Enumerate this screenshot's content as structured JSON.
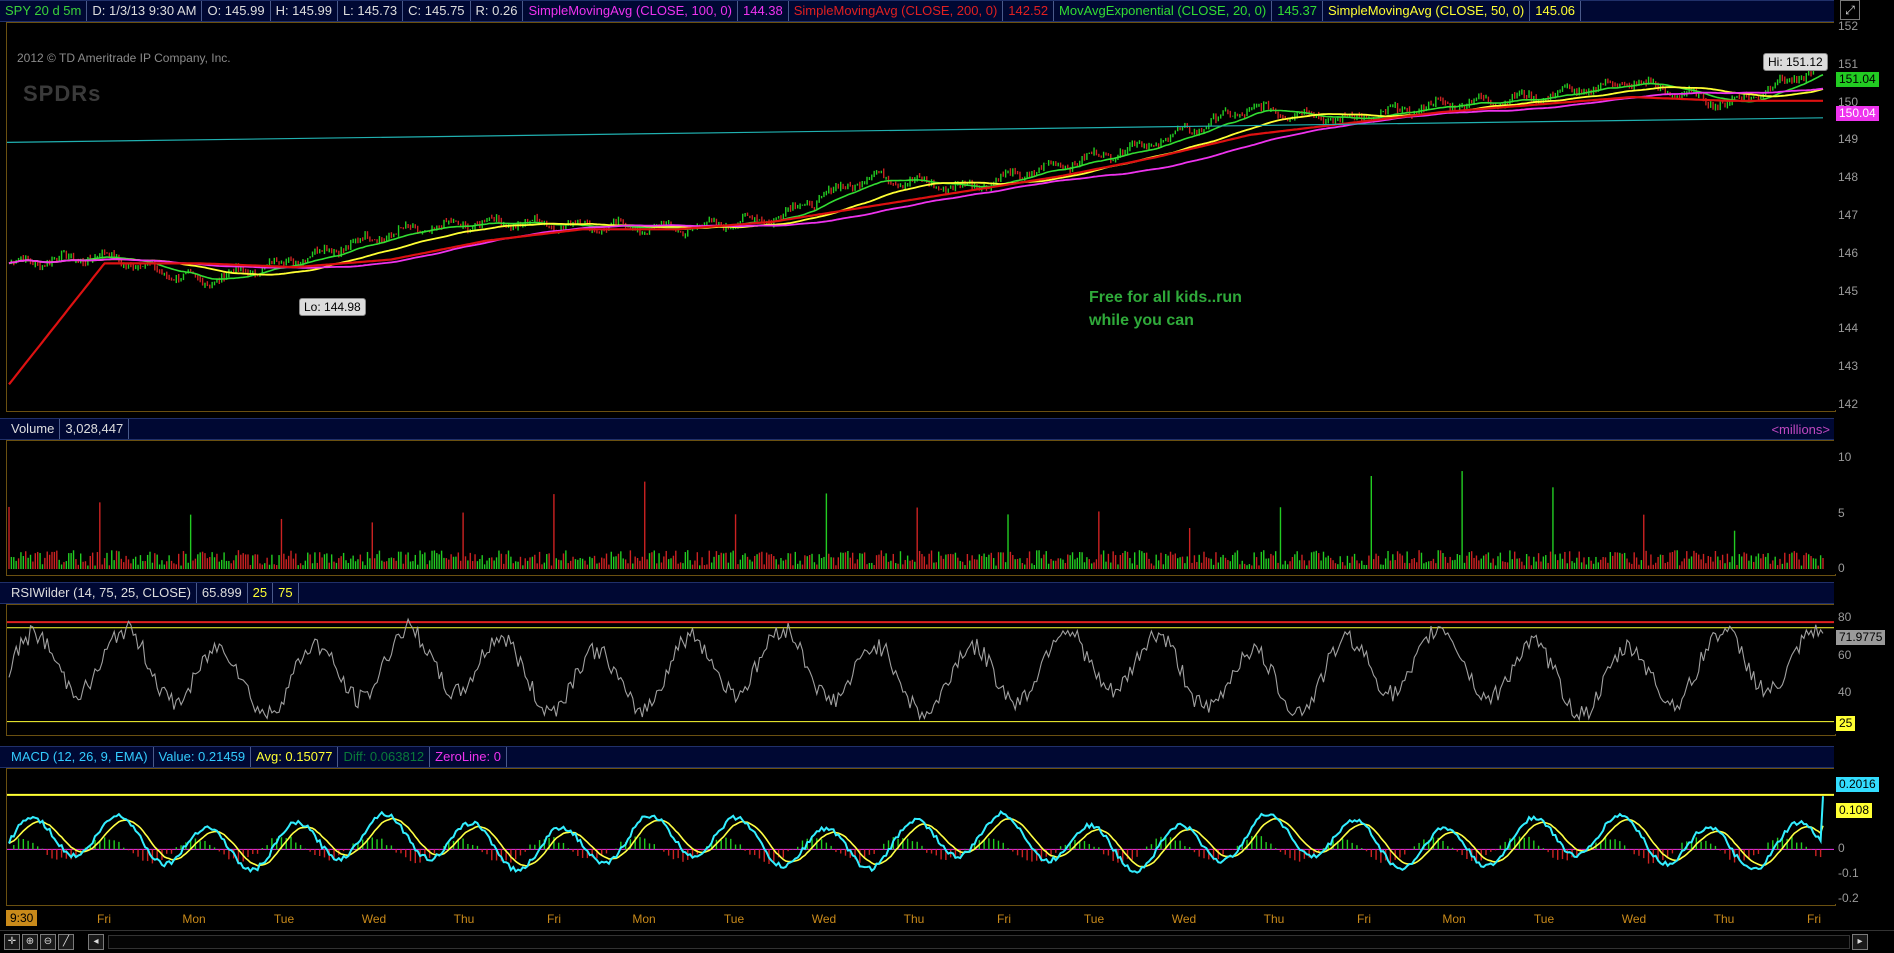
{
  "top_bar": {
    "symbol": "SPY 20 d 5m",
    "datetime": "D: 1/3/13 9:30 AM",
    "open": "O: 145.99",
    "high": "H: 145.99",
    "low": "L: 145.73",
    "close": "C: 145.75",
    "range": "R: 0.26",
    "sma100_label": "SimpleMovingAvg (CLOSE, 100, 0)",
    "sma100_value": "144.38",
    "sma200_label": "SimpleMovingAvg (CLOSE, 200, 0)",
    "sma200_value": "142.52",
    "ema20_label": "MovAvgExponential (CLOSE, 20, 0)",
    "ema20_value": "145.37",
    "sma50_label": "SimpleMovingAvg (CLOSE, 50, 0)",
    "sma50_value": "145.06"
  },
  "watermark": {
    "copyright": "2012 © TD Ameritrade IP Company, Inc.",
    "logo": "SPDRs"
  },
  "annotation": {
    "line1": "Free for all kids..run",
    "line2": "while you can"
  },
  "price_labels": {
    "hi": "Hi: 151.12",
    "lo": "Lo: 144.98",
    "last_green": "151.04",
    "last_magenta": "150.04"
  },
  "volume_bar": {
    "title": "Volume",
    "value": "3,028,447",
    "units": "<millions>"
  },
  "rsi_bar": {
    "title": "RSIWilder (14, 75, 25, CLOSE)",
    "value": "65.899",
    "oversold": "25",
    "overbought": "75",
    "last_tag": "71.9775",
    "low_tag": "25"
  },
  "macd_bar": {
    "title": "MACD (12, 26, 9, EMA)",
    "value": "Value: 0.21459",
    "avg": "Avg: 0.15077",
    "diff": "Diff: 0.063812",
    "zero": "ZeroLine: 0",
    "tag_value": "0.2016",
    "tag_avg": "0.108"
  },
  "time_cursor": "9:30",
  "colors": {
    "price_up": "#22cc22",
    "price_down": "#cc2222",
    "ema20": "#33dd33",
    "sma50": "#ffff33",
    "sma100": "#ee33ee",
    "sma200": "#dd1111",
    "trendline": "#20b0b0",
    "rsi": "#a0a0a0",
    "macd": "#33eeff",
    "macd_avg": "#ffff44"
  },
  "chart_data": [
    {
      "type": "line",
      "name": "price",
      "x": [
        "Fri",
        "Mon",
        "Tue",
        "Wed",
        "Thu",
        "Fri",
        "Mon",
        "Tue",
        "Wed",
        "Thu",
        "Fri",
        "Tue",
        "Wed",
        "Thu",
        "Fri",
        "Mon",
        "Tue",
        "Wed",
        "Thu",
        "Fri"
      ],
      "series": [
        {
          "name": "close",
          "values": [
            145.8,
            146.0,
            145.3,
            145.9,
            146.6,
            146.9,
            146.8,
            146.7,
            147.0,
            148.1,
            147.8,
            148.4,
            149.0,
            149.9,
            149.6,
            150.0,
            150.2,
            150.6,
            150.0,
            151.0
          ]
        },
        {
          "name": "SimpleMovingAvg (CLOSE, 200, 0)",
          "values": [
            142.6,
            145.8,
            145.8,
            145.7,
            145.9,
            146.4,
            146.7,
            146.7,
            146.9,
            147.3,
            147.7,
            148.1,
            148.6,
            149.2,
            149.5,
            149.8,
            150.0,
            150.2,
            150.1,
            150.1
          ]
        }
      ],
      "ylim": [
        142,
        152
      ],
      "yticks": [
        142,
        143,
        144,
        145,
        146,
        147,
        148,
        149,
        150,
        151,
        152
      ],
      "hi": 151.12,
      "lo": 144.98
    },
    {
      "type": "bar",
      "name": "volume",
      "ylabel": "<millions>",
      "ylim": [
        0,
        11
      ],
      "yticks": [
        0,
        5,
        10
      ]
    },
    {
      "type": "line",
      "name": "RSIWilder",
      "ylim": [
        20,
        85
      ],
      "yticks": [
        40,
        60,
        80
      ],
      "overbought": 75,
      "oversold": 25,
      "last": 71.9775
    },
    {
      "type": "line",
      "name": "MACD",
      "ylim": [
        -0.2,
        0.3
      ],
      "yticks": [
        -0.2,
        -0.1,
        0
      ],
      "value": 0.21459,
      "avg": 0.15077,
      "diff": 0.063812
    }
  ]
}
